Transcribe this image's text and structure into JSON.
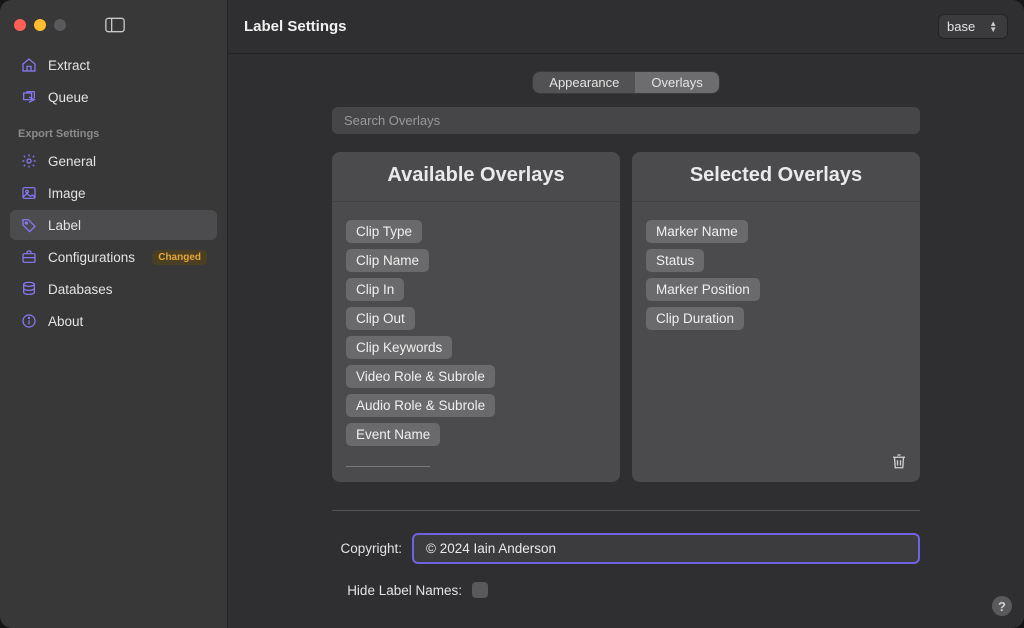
{
  "window": {
    "title": "Label Settings",
    "preset": "base"
  },
  "sidebar": {
    "top": [
      {
        "icon": "home-icon",
        "label": "Extract"
      },
      {
        "icon": "queue-icon",
        "label": "Queue"
      }
    ],
    "section_label": "Export Settings",
    "settings": [
      {
        "icon": "gear-icon",
        "label": "General",
        "selected": false,
        "badge": ""
      },
      {
        "icon": "image-icon",
        "label": "Image",
        "selected": false,
        "badge": ""
      },
      {
        "icon": "tag-icon",
        "label": "Label",
        "selected": true,
        "badge": ""
      },
      {
        "icon": "briefcase-icon",
        "label": "Configurations",
        "selected": false,
        "badge": "Changed"
      },
      {
        "icon": "database-icon",
        "label": "Databases",
        "selected": false,
        "badge": ""
      },
      {
        "icon": "info-icon",
        "label": "About",
        "selected": false,
        "badge": ""
      }
    ]
  },
  "tabs": {
    "appearance": "Appearance",
    "overlays": "Overlays",
    "active": "overlays"
  },
  "search": {
    "placeholder": "Search Overlays",
    "value": ""
  },
  "panels": {
    "available": {
      "title": "Available Overlays",
      "items": [
        "Clip Type",
        "Clip Name",
        "Clip In",
        "Clip Out",
        "Clip Keywords",
        "Video Role & Subrole",
        "Audio Role & Subrole",
        "Event Name"
      ]
    },
    "selected": {
      "title": "Selected Overlays",
      "items": [
        "Marker Name",
        "Status",
        "Marker Position",
        "Clip Duration"
      ]
    }
  },
  "form": {
    "copyright_label": "Copyright:",
    "copyright_value": "© 2024 Iain Anderson",
    "hide_names_label": "Hide Label Names:",
    "hide_names_checked": false
  },
  "help": "?"
}
